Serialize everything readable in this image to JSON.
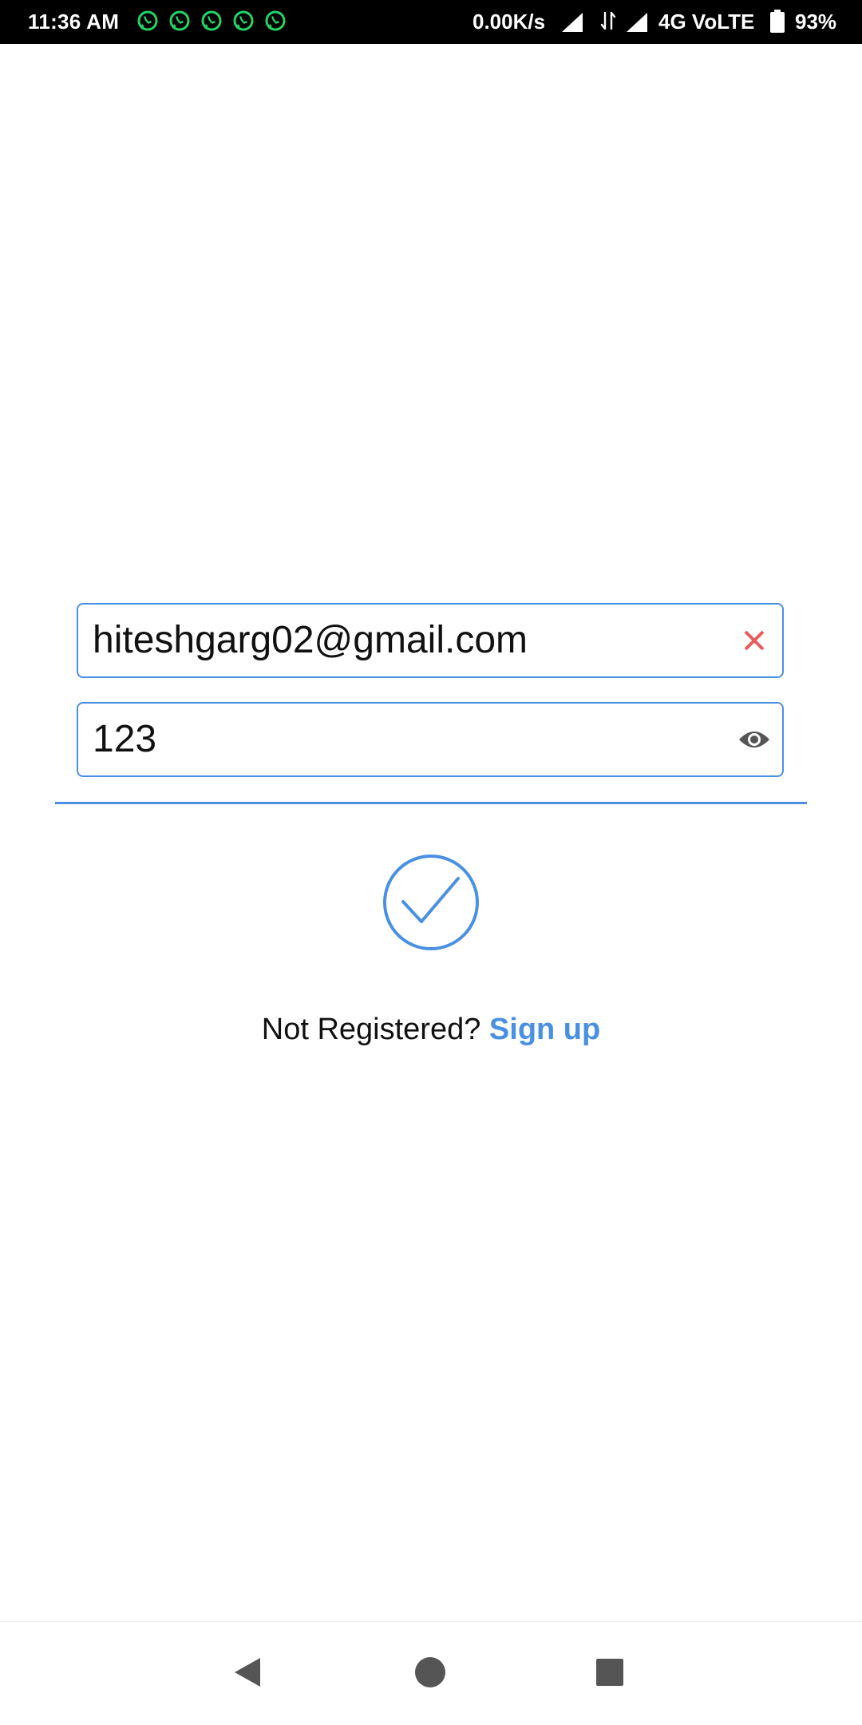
{
  "status_bar": {
    "time": "11:36 AM",
    "notification_icons": [
      "whatsapp-icon",
      "whatsapp-icon",
      "whatsapp-icon",
      "whatsapp-icon",
      "whatsapp-icon"
    ],
    "network_speed": "0.00K/s",
    "network_type": "4G VoLTE",
    "battery_percent": "93%"
  },
  "login": {
    "email": {
      "value": "hiteshgarg02@gmail.com",
      "action_icon": "clear-icon"
    },
    "password": {
      "value": "123",
      "action_icon": "eye-icon"
    },
    "submit_icon": "check-circle-icon",
    "signup_prompt": "Not Registered?",
    "signup_link": "Sign up"
  },
  "nav_bar": {
    "icons": [
      "back-icon",
      "home-icon",
      "recents-icon"
    ]
  },
  "colors": {
    "accent": "#4a90e2",
    "clear": "#e85c5c",
    "text": "#111111",
    "status_bar_bg": "#000000"
  }
}
